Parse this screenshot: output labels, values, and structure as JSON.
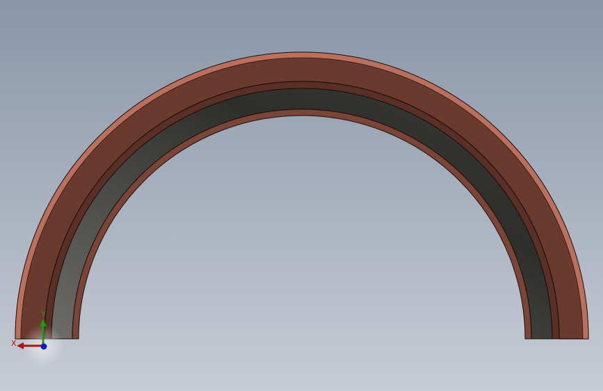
{
  "viewport": {
    "background_top": "#8996a8",
    "background_bottom": "#c7cbd5"
  },
  "part": {
    "shape": "half-ring",
    "outer_ring_color": "#6b3a2e",
    "outer_ring_highlight": "#c87a66",
    "inner_lip_color": "#5a2f26",
    "inner_surface_color_dark": "#2e2e2b",
    "inner_surface_color_light": "#6d6c68",
    "edge_color": "#1a0f0c"
  },
  "triad": {
    "x_label": "X",
    "y_label": "Y",
    "x_color": "#b01010",
    "y_color": "#12a012",
    "z_color": "#1020c0"
  }
}
